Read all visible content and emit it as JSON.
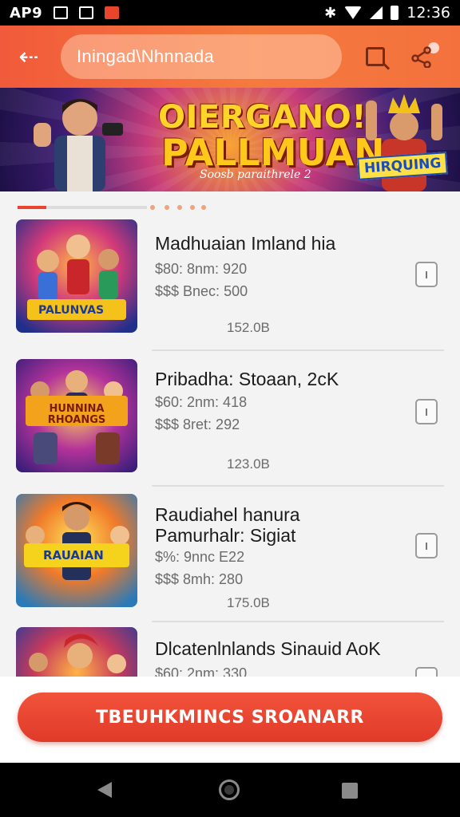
{
  "status_bar": {
    "app_tag": "AP9",
    "time": "12:36",
    "icons": [
      "image-icon",
      "image-icon",
      "notification-icon",
      "bluetooth-icon",
      "wifi-icon",
      "signal-icon",
      "battery-icon"
    ]
  },
  "app_bar": {
    "back_icon": "back-arrow-icon",
    "search_text": "Iningad\\Nhnnada",
    "search_icon": "search-icon",
    "share_icon": "share-icon"
  },
  "banner": {
    "title_line1": "OIERGANO!",
    "title_line2": "PALLMUAN",
    "subtitle": "Soosb paraithrele 2",
    "badge": "HIRQUING"
  },
  "carousel": {
    "dot_count": 5,
    "active_index": 0
  },
  "games": [
    {
      "title_lines": [
        "Madhuaian Imland hia"
      ],
      "line1": "$80: 8nm: 920",
      "line2": "$$$ Bnec: 500",
      "total": "152.0B",
      "thumb_caption": "PALUNVAS"
    },
    {
      "title_lines": [
        "Pribadha: Stoaan, 2cK"
      ],
      "line1": "$60: 2nm: 418",
      "line2": "$$$ 8ret: 292",
      "total": "123.0B",
      "thumb_caption": "HUNNINA RHOANGS"
    },
    {
      "title_lines": [
        "Raudiahel hanura",
        "Pamurhalr: Sigiat"
      ],
      "line1": "$%: 9nnc E22",
      "line2": "$$$ 8mh: 280",
      "total": "175.0B",
      "thumb_caption": "RAUAIAN"
    },
    {
      "title_lines": [
        "Dlcatenlnlands Sinauid AoK"
      ],
      "line1": "$60: 2nm: 330",
      "line2": "",
      "total": "",
      "thumb_caption": ""
    }
  ],
  "cta": {
    "label": "TBEUHKMINCS SROANARR"
  },
  "nav_bar": {
    "icons": [
      "nav-back-icon",
      "nav-home-icon",
      "nav-recents-icon"
    ]
  },
  "colors": {
    "accent": "#e8452c",
    "app_bar_start": "#f15a3a",
    "app_bar_end": "#f57a3e",
    "text_primary": "#1b1b1b",
    "text_secondary": "#6b6b6b"
  }
}
